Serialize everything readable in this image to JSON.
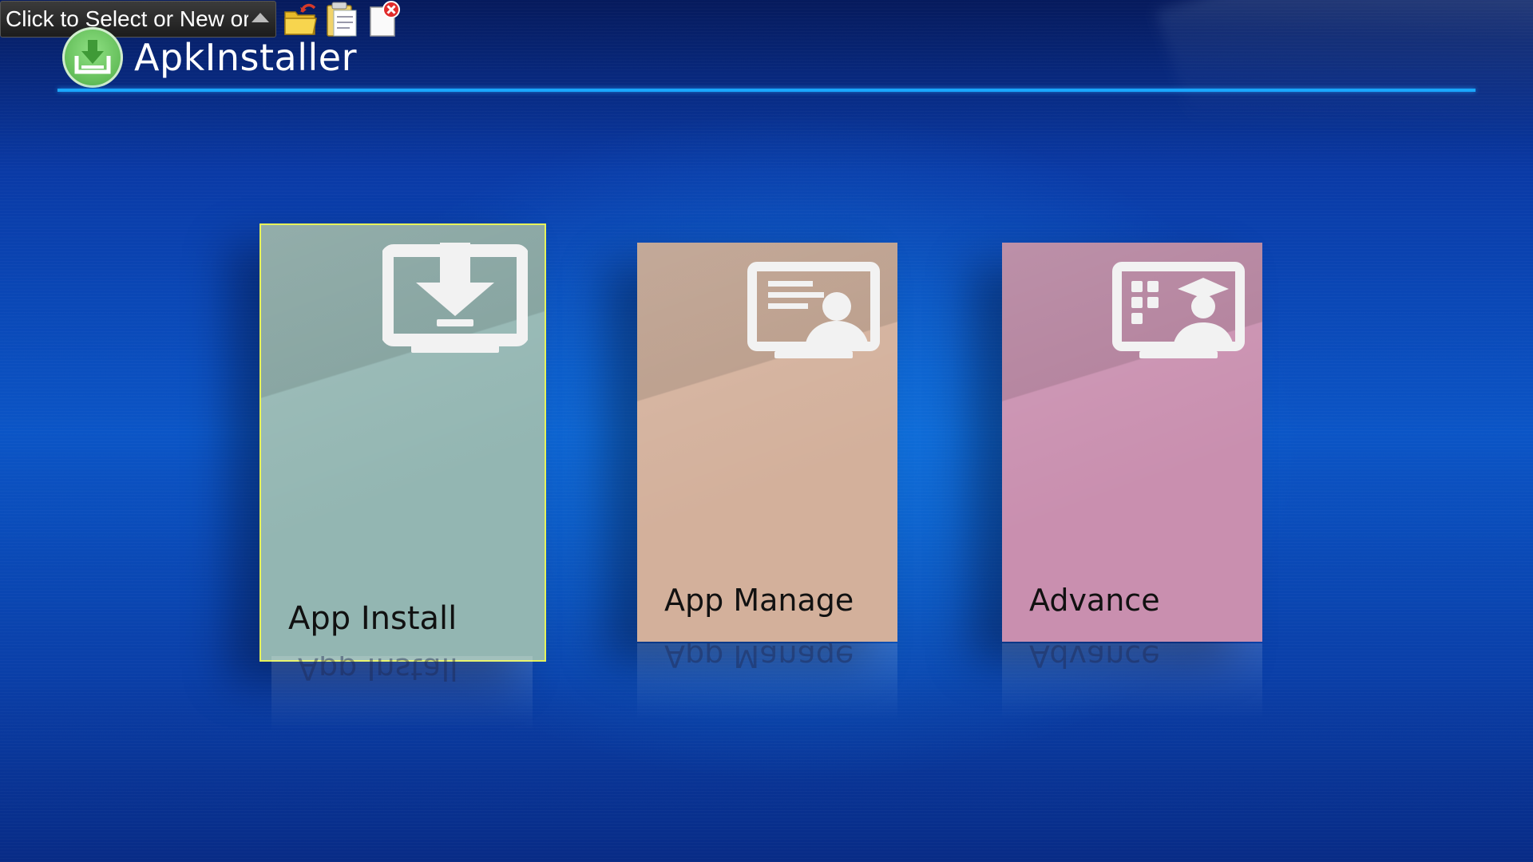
{
  "toolbar": {
    "file_select_text": "Click to Select or New or",
    "icons": [
      "folder-open-icon",
      "clipboard-icon",
      "document-delete-icon"
    ]
  },
  "header": {
    "title": "ApkInstaller",
    "logo_icon": "apk-installer-logo-icon"
  },
  "cards": [
    {
      "label": "App Install",
      "icon": "monitor-download-icon",
      "color": "#93b6b2",
      "focused": true
    },
    {
      "label": "App Manage",
      "icon": "monitor-profile-icon",
      "color": "#d3b09b",
      "focused": false
    },
    {
      "label": "Advance",
      "icon": "monitor-graduate-icon",
      "color": "#c98faf",
      "focused": false
    }
  ],
  "colors": {
    "accent_line": "#1aa7ff",
    "focus_border": "#e6f25a"
  }
}
